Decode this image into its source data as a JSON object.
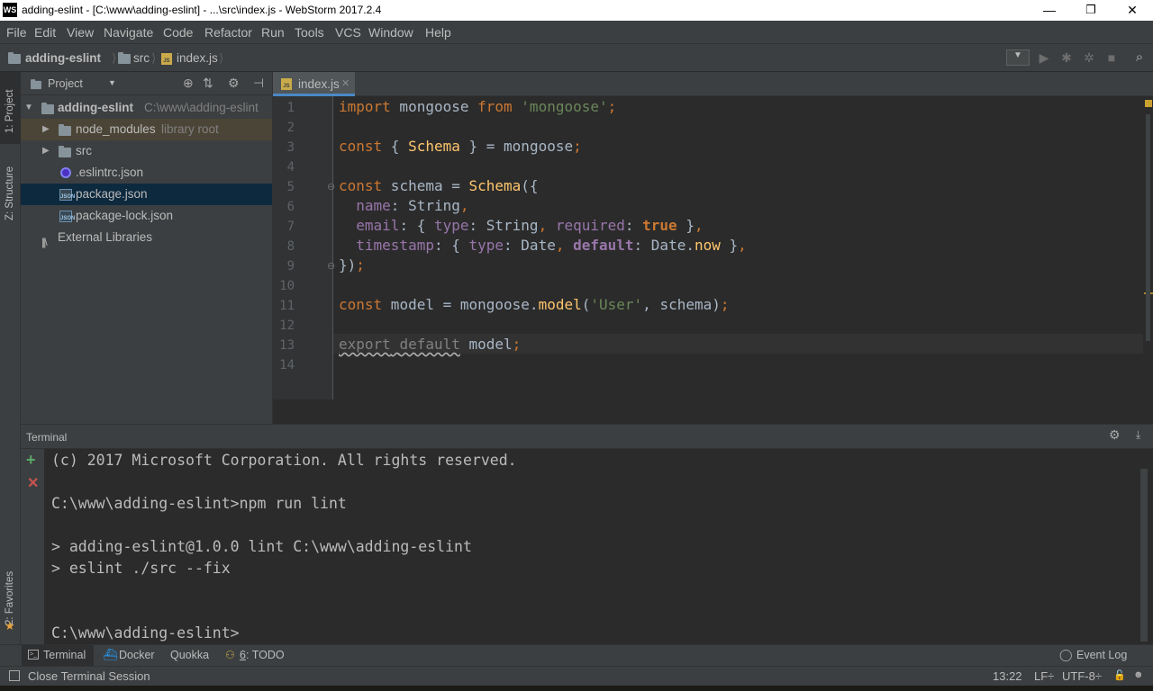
{
  "window": {
    "title": "adding-eslint - [C:\\www\\adding-eslint] - ...\\src\\index.js - WebStorm 2017.2.4",
    "logo": "WS",
    "controls": {
      "minimize": "—",
      "maximize": "❐",
      "close": "✕"
    }
  },
  "menu": [
    "File",
    "Edit",
    "View",
    "Navigate",
    "Code",
    "Refactor",
    "Run",
    "Tools",
    "VCS",
    "Window",
    "Help"
  ],
  "breadcrumb": {
    "project": "adding-eslint",
    "folder": "src",
    "file": "index.js"
  },
  "left_strip": {
    "project_tab": "1: Project",
    "structure_tab": "Z: Structure",
    "favorites_tab": "2: Favorites"
  },
  "project_panel": {
    "header": "Project",
    "tree": {
      "root": {
        "name": "adding-eslint",
        "path": "C:\\www\\adding-eslint"
      },
      "node_modules": {
        "name": "node_modules",
        "note": "library root"
      },
      "src": "src",
      "eslintrc": ".eslintrc.json",
      "package": "package.json",
      "package_lock": "package-lock.json",
      "external": "External Libraries"
    }
  },
  "editor": {
    "tab_label": "index.js",
    "line_numbers": [
      "1",
      "2",
      "3",
      "4",
      "5",
      "6",
      "7",
      "8",
      "9",
      "10",
      "11",
      "12",
      "13",
      "14"
    ],
    "code": {
      "l1": {
        "a": "import",
        "b": " mongoose ",
        "c": "from",
        "d": " ",
        "e": "'mongoose'",
        "f": ";"
      },
      "l3": {
        "a": "const",
        "b": " { ",
        "c": "Schema",
        "d": " } = mongoose",
        "e": ";"
      },
      "l5": {
        "a": "const",
        "b": " schema = ",
        "c": "Schema",
        "d": "({"
      },
      "l6": {
        "a": "  name",
        "b": ": String",
        "c": ","
      },
      "l7": {
        "a": "  email",
        "b": ": { ",
        "c": "type",
        "d": ": String",
        "e": ", ",
        "f": "required",
        "g": ": ",
        "h": "true",
        "i": " }",
        "j": ","
      },
      "l8": {
        "a": "  timestamp",
        "b": ": { ",
        "c": "type",
        "d": ": Date",
        "e": ", ",
        "f": "default",
        "g": ": Date.",
        "h": "now",
        "i": " }",
        "j": ","
      },
      "l9": {
        "a": "})",
        "b": ";"
      },
      "l11": {
        "a": "const",
        "b": " model = mongoose.",
        "c": "model",
        "d": "(",
        "e": "'User'",
        "f": ", schema)",
        "g": ";"
      },
      "l13": {
        "a": "export",
        "b": " ",
        "c": "default",
        "d": " model",
        "e": ";"
      }
    }
  },
  "terminal": {
    "header": "Terminal",
    "lines": [
      "(c) 2017 Microsoft Corporation. All rights reserved.",
      "C:\\www\\adding-eslint>npm run lint",
      "> adding-eslint@1.0.0 lint C:\\www\\adding-eslint",
      "> eslint ./src --fix",
      "C:\\www\\adding-eslint>"
    ]
  },
  "bottom_tabs": {
    "terminal": "Terminal",
    "docker": "Docker",
    "quokka": "Quokka",
    "todo_num": "6",
    "todo": ": TODO",
    "event_log": "Event Log"
  },
  "status": {
    "message": "Close Terminal Session",
    "position": "13:22",
    "line_sep": "LF÷",
    "encoding": "UTF-8÷"
  }
}
